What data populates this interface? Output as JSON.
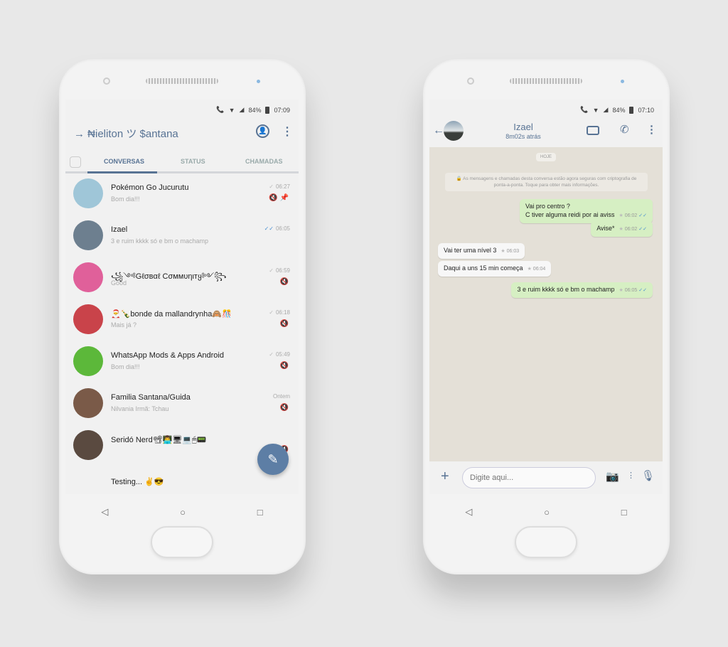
{
  "left": {
    "status": {
      "battery": "84%",
      "time": "07:09"
    },
    "title": "→ ₦ieliton ツ $antana",
    "tabs": [
      "CONVERSAS",
      "STATUS",
      "CHAMADAS"
    ],
    "chats": [
      {
        "name": "Pokémon Go Jucurutu",
        "preview": "Bom dia!!!",
        "time": "06:27",
        "tick": "✓",
        "read": false,
        "muted": true,
        "pinned": true,
        "avatar": "#9fc6d8"
      },
      {
        "name": "Izael",
        "preview": "3 e ruim kkkk só e bm o machamp",
        "time": "06:05",
        "tick": "✓✓",
        "read": true,
        "muted": false,
        "avatar": "#6d7f8f"
      },
      {
        "name": "꧁༺Gℓσвαℓ Cσммυηιтყ༻꧂",
        "preview": "Good",
        "time": "06:59",
        "tick": "✓",
        "read": false,
        "muted": true,
        "avatar": "#e0609a"
      },
      {
        "name": "🎅🍾bonde da mallandrynha🙈🎊",
        "preview": "Mais já ?",
        "time": "06:18",
        "tick": "✓",
        "read": false,
        "muted": true,
        "avatar": "#c9434a"
      },
      {
        "name": "WhatsApp Mods & Apps Android",
        "preview": "Bom dia!!!",
        "time": "05:49",
        "tick": "✓",
        "read": false,
        "muted": true,
        "avatar": "#5cb83a"
      },
      {
        "name": "Familia Santana/Guida",
        "preview": "Nilvania Irmã: Tchau",
        "time": "Ontem",
        "tick": "",
        "read": false,
        "muted": true,
        "avatar": "#7a5a48"
      },
      {
        "name": "Seridó Nerd📽👨‍💻🖥💻🖱📟",
        "preview": "",
        "time": "",
        "tick": "",
        "read": false,
        "muted": true,
        "avatar": "#5a4a40"
      },
      {
        "name": "Testing... ✌😎",
        "preview": "",
        "time": "",
        "tick": "",
        "read": false,
        "muted": false,
        "avatar": ""
      }
    ],
    "fab_icon": "pencil-icon"
  },
  "right": {
    "status": {
      "battery": "84%",
      "time": "07:10"
    },
    "contact": "Izael",
    "last_seen": "8m02s atrás",
    "date_chip": "HOJE",
    "encryption_notice": "🔒 As mensagens e chamadas desta conversa estão agora seguras com criptografia de ponta-a-ponta. Toque para obter mais informações.",
    "messages": [
      {
        "dir": "out",
        "lines": [
          "Vai pro centro ?",
          "C tiver alguma reidi por ai aviss"
        ],
        "time": "06:02"
      },
      {
        "dir": "out",
        "lines": [
          "Avise*"
        ],
        "time": "06:02"
      },
      {
        "dir": "in",
        "lines": [
          "Vai ter uma nível 3"
        ],
        "time": "06:03"
      },
      {
        "dir": "in",
        "lines": [
          "Daqui a uns 15 min começa"
        ],
        "time": "06:04"
      },
      {
        "dir": "out",
        "lines": [
          "3 e ruim kkkk só e bm o machamp"
        ],
        "time": "06:05"
      }
    ],
    "input_placeholder": "Digite aqui..."
  },
  "colors": {
    "accent": "#587394",
    "fab": "#5d7ea5",
    "outgoing": "#d6efc3",
    "chat_bg": "#e4e0d7"
  }
}
